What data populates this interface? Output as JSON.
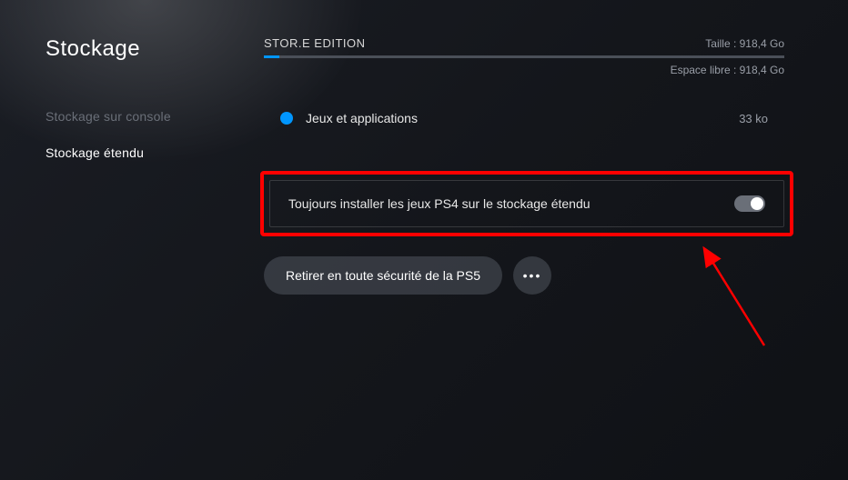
{
  "page": {
    "title": "Stockage"
  },
  "sidebar": {
    "items": [
      {
        "label": "Stockage sur console",
        "active": false
      },
      {
        "label": "Stockage étendu",
        "active": true
      }
    ]
  },
  "storage": {
    "name": "STOR.E EDITION",
    "size_label": "Taille : 918,4 Go",
    "free_label": "Espace libre : 918,4 Go"
  },
  "category": {
    "label": "Jeux et applications",
    "value": "33 ko",
    "dot_color": "#0096ff"
  },
  "toggle": {
    "label": "Toujours installer les jeux PS4 sur le stockage étendu",
    "state": "on"
  },
  "actions": {
    "remove_label": "Retirer en toute sécurité de la PS5",
    "more_glyph": "•••"
  },
  "annotation": {
    "highlight_color": "#ff0000"
  }
}
